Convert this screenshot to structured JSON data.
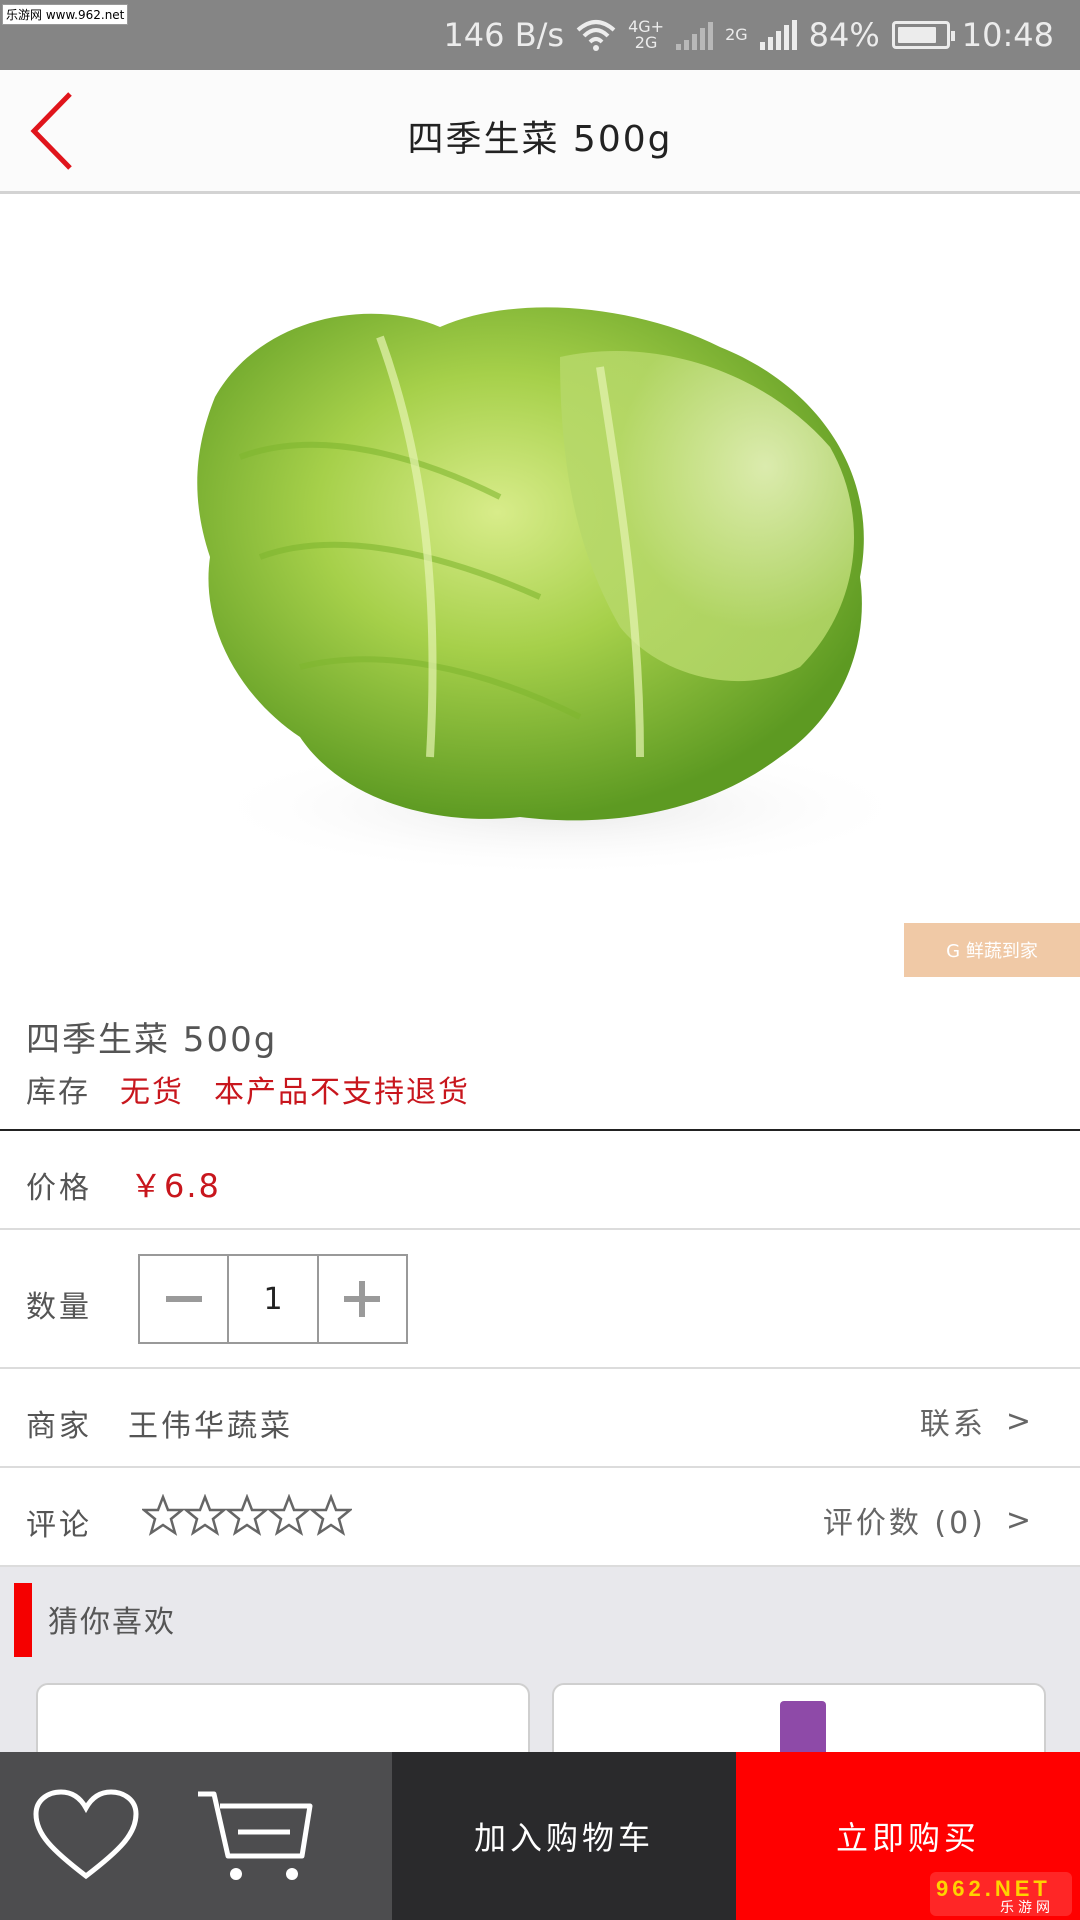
{
  "status_bar": {
    "watermark": "乐游网 www.962.net",
    "net_speed": "146 B/s",
    "network_primary_top": "4G+",
    "network_primary_bottom": "2G",
    "network_secondary": "2G",
    "battery": "84%",
    "time": "10:48"
  },
  "header": {
    "title": "四季生菜 500g",
    "back_icon": "chevron-left-icon"
  },
  "product_image": {
    "alt": "lettuce",
    "badge": "G 鲜蔬到家"
  },
  "product": {
    "name": "四季生菜 500g",
    "stock_label": "库存",
    "stock_value": "无货",
    "stock_note": "本产品不支持退货"
  },
  "price": {
    "label": "价格",
    "value": "￥6.8"
  },
  "quantity": {
    "label": "数量",
    "value": "1"
  },
  "merchant": {
    "label": "商家",
    "name": "王伟华蔬菜",
    "contact_label": "联系",
    "chevron": ">"
  },
  "review": {
    "label": "评论",
    "rating": 0,
    "max_rating": 5,
    "count_label": "评价数 (0)",
    "chevron": ">"
  },
  "recommend": {
    "title": "猜你喜欢"
  },
  "bottom_bar": {
    "add_to_cart": "加入购物车",
    "buy_now": "立即购买",
    "logo_text": "962.NET",
    "logo_sub": "乐游网"
  },
  "colors": {
    "accent_red": "#c8161d",
    "buy_red": "#ff0000",
    "dark_bar": "#2a2a2c",
    "icon_bar": "#4d4d4f"
  }
}
